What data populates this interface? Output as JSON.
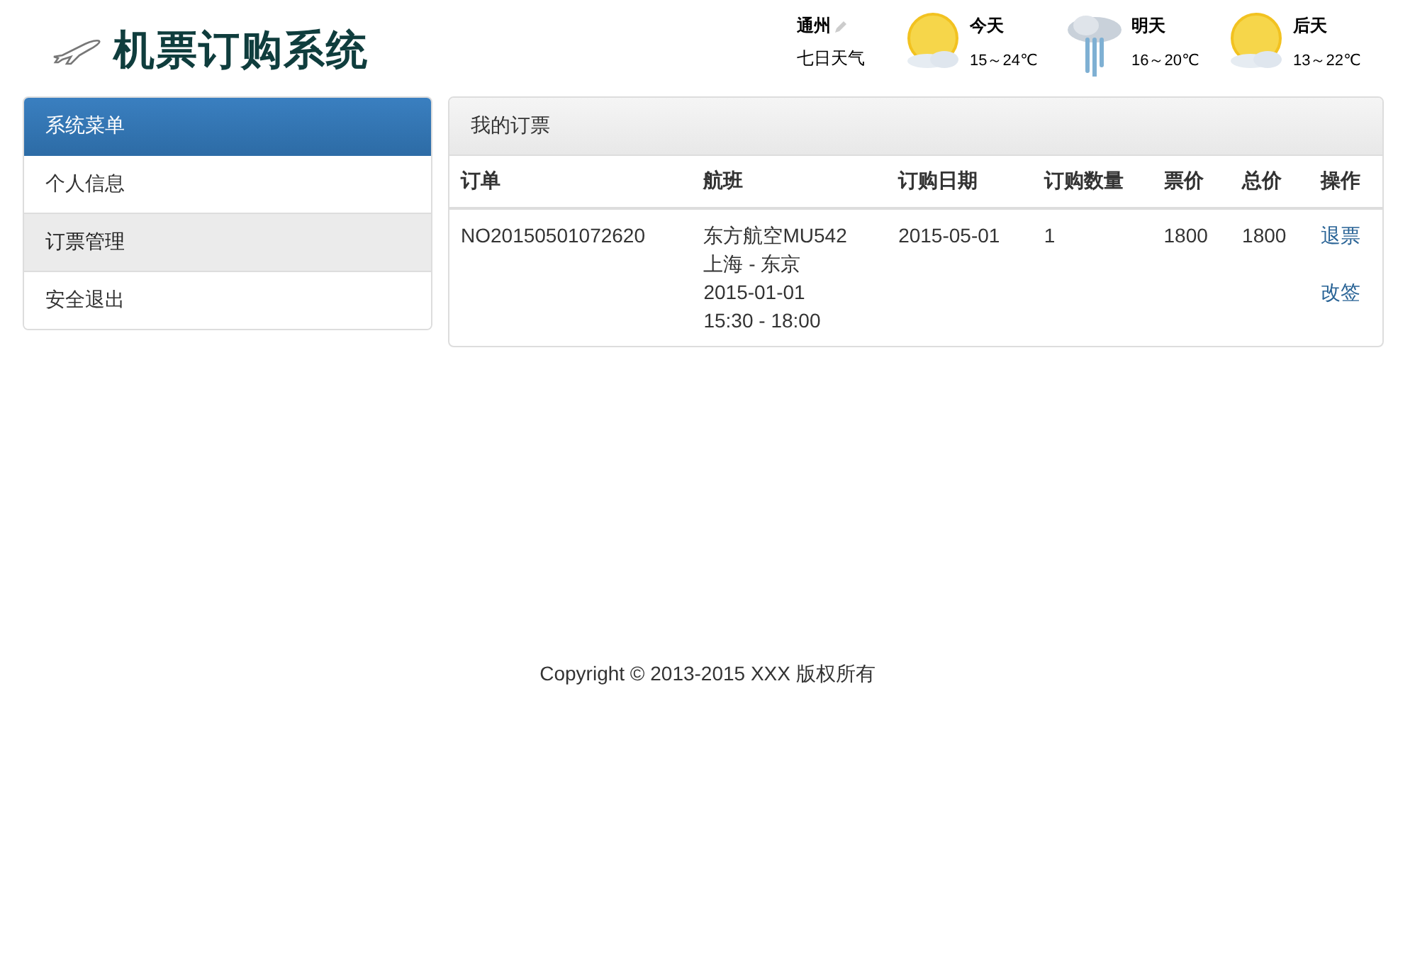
{
  "header": {
    "title": "机票订购系统"
  },
  "weather": {
    "city": "通州",
    "subtitle": "七日天气",
    "days": [
      {
        "label": "今天",
        "temp": "15～24℃",
        "kind": "sunny"
      },
      {
        "label": "明天",
        "temp": "16～20℃",
        "kind": "rain"
      },
      {
        "label": "后天",
        "temp": "13～22℃",
        "kind": "sunny"
      }
    ]
  },
  "sidebar": {
    "heading": "系统菜单",
    "items": [
      {
        "label": "个人信息",
        "selected": false
      },
      {
        "label": "订票管理",
        "selected": true
      },
      {
        "label": "安全退出",
        "selected": false
      }
    ]
  },
  "panel": {
    "title": "我的订票"
  },
  "table": {
    "columns": [
      "订单",
      "航班",
      "订购日期",
      "订购数量",
      "票价",
      "总价",
      "操作"
    ],
    "rows": [
      {
        "order": "NO20150501072620",
        "flight": [
          "东方航空MU542",
          "上海 - 东京",
          "2015-01-01",
          "15:30 - 18:00"
        ],
        "date": "2015-05-01",
        "quantity": "1",
        "price": "1800",
        "total": "1800",
        "actions": [
          "退票",
          "改签"
        ]
      }
    ]
  },
  "footer": "Copyright © 2013-2015 XXX 版权所有"
}
